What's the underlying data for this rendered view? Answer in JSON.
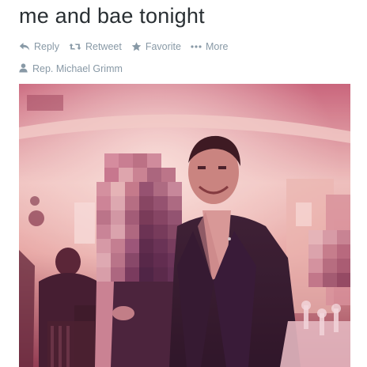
{
  "tweet": {
    "text": "me and bae tonight"
  },
  "actions": {
    "reply": "Reply",
    "retweet": "Retweet",
    "favorite": "Favorite",
    "more": "More"
  },
  "attribution": {
    "name": "Rep. Michael Grimm"
  },
  "colors": {
    "text": "#292f33",
    "muted": "#8899a6"
  },
  "icons": [
    "reply-icon",
    "retweet-icon",
    "star-icon",
    "more-dots-icon",
    "person-icon"
  ]
}
